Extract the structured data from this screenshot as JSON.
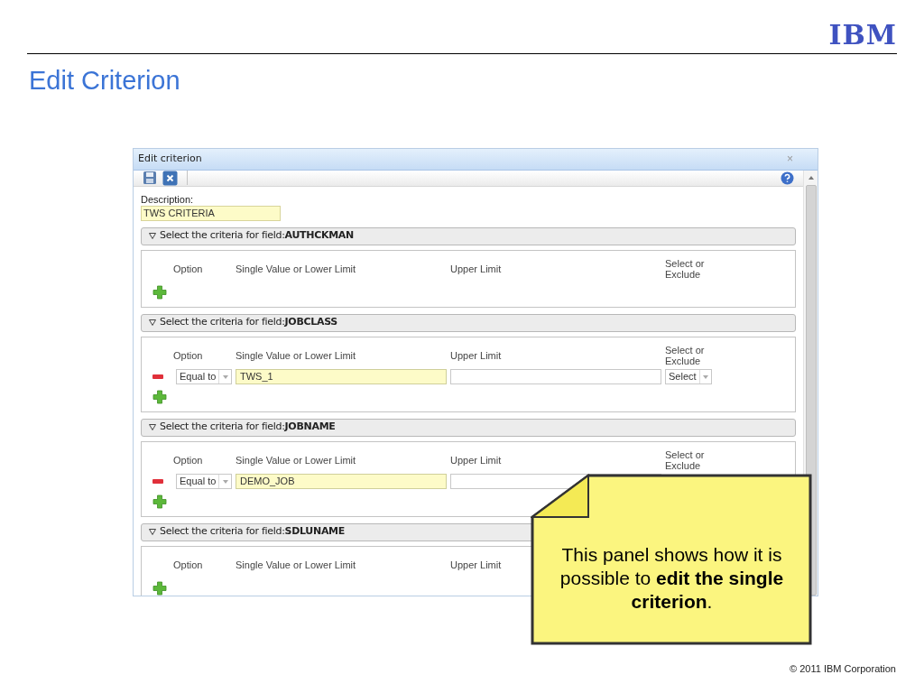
{
  "header": {
    "logo": "IBM",
    "title": "Edit Criterion"
  },
  "dialog": {
    "title": "Edit criterion",
    "close": "×",
    "description": {
      "label": "Description:",
      "value": "TWS CRITERIA"
    },
    "sections": [
      {
        "heading": "Select the criteria for field:**AUTHCKMAN**",
        "expanded": true,
        "headers": [
          "Option",
          "Single Value or Lower Limit",
          "Upper Limit",
          "Select or Exclude"
        ]
      },
      {
        "heading": "Select the criteria for field:**JOBCLASS**",
        "expanded": true,
        "headers": [
          "Option",
          "Single Value or Lower Limit",
          "Upper Limit",
          "Select or Exclude"
        ],
        "rows": [
          {
            "option": "Equal to",
            "value": "TWS_1",
            "select": "Select"
          }
        ]
      },
      {
        "heading": "Select the criteria for field:**JOBNAME**",
        "expanded": true,
        "headers": [
          "Option",
          "Single Value or Lower Limit",
          "Upper Limit",
          "Select or Exclude"
        ],
        "rows": [
          {
            "option": "Equal to",
            "value": "DEMO_JOB"
          }
        ]
      },
      {
        "heading": "Select the criteria for field:**SDLUNAME**",
        "expanded": true,
        "headers": [
          "Option",
          "Single Value or Lower Limit",
          "Upper Limit"
        ]
      }
    ]
  },
  "callout": {
    "text": "This panel shows how it is possible to **edit the single criterion**."
  },
  "footer": "© 2011 IBM Corporation"
}
